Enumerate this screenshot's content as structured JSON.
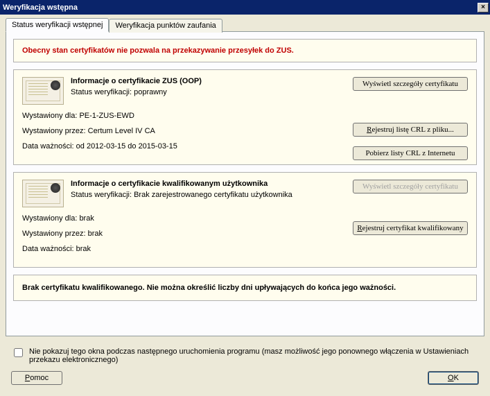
{
  "window": {
    "title": "Weryfikacja wstępna",
    "close": "×"
  },
  "tabs": {
    "active": "Status weryfikacji wstępnej",
    "inactive": "Weryfikacja punktów zaufania"
  },
  "warning": "Obecny stan certyfikatów nie pozwala na przekazywanie przesyłek do ZUS.",
  "cert1": {
    "title": "Informacje o certyfikacie ZUS (OOP)",
    "status_label": "Status weryfikacji:",
    "status_value": "poprawny",
    "issued_to_label": "Wystawiony dla:",
    "issued_to_value": "PE-1-ZUS-EWD",
    "issued_by_label": "Wystawiony przez:",
    "issued_by_value": "Certum Level IV CA",
    "valid_label": "Data ważności:",
    "valid_value": "od 2012-03-15 do 2015-03-15",
    "btn_details": "Wyświetl szczegóły certyfikatu",
    "btn_crl_file": "Rejestruj listę CRL z pliku...",
    "btn_crl_net": "Pobierz listy CRL z Internetu"
  },
  "cert2": {
    "title": "Informacje o certyfikacie kwalifikowanym użytkownika",
    "status_label": "Status weryfikacji:",
    "status_value": "Brak zarejestrowanego certyfikatu użytkownika",
    "issued_to_label": "Wystawiony dla:",
    "issued_to_value": "brak",
    "issued_by_label": "Wystawiony przez:",
    "issued_by_value": "brak",
    "valid_label": "Data ważności:",
    "valid_value": "brak",
    "btn_details": "Wyświetl szczegóły certyfikatu",
    "btn_register": "Rejestruj certyfikat kwalifikowany"
  },
  "summary": "Brak certyfikatu kwalifikowanego. Nie można określić liczby dni upływających do końca jego ważności.",
  "checkbox_label": "Nie pokazuj tego okna podczas następnego uruchomienia programu (masz możliwość jego ponownego włączenia w Ustawieniach przekazu elektronicznego)",
  "buttons": {
    "help": "Pomoc",
    "ok": "OK"
  }
}
